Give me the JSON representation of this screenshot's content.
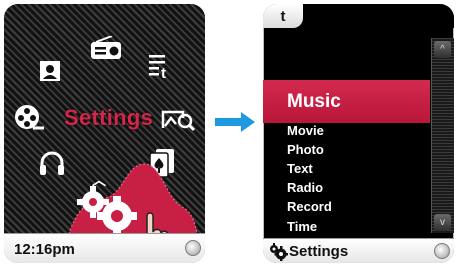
{
  "left_screen": {
    "title_label": "Settings",
    "time": "12:16pm",
    "icons": [
      "photo-icon",
      "radio-icon",
      "text-icon",
      "movie-icon",
      "image-search-icon",
      "headphones-icon",
      "cards-icon",
      "gears-icon",
      "up-chevron-icon",
      "hand-cursor-icon"
    ]
  },
  "right_screen": {
    "back_label": "t",
    "menu": {
      "selected": "Music",
      "items": [
        "Movie",
        "Photo",
        "Text",
        "Radio",
        "Record",
        "Time"
      ]
    },
    "footer_title": "Settings",
    "scroll_up_glyph": "^",
    "scroll_down_glyph": "v"
  },
  "colors": {
    "accent": "#c81f45",
    "arrow": "#1e9be0",
    "background": "#000000"
  }
}
